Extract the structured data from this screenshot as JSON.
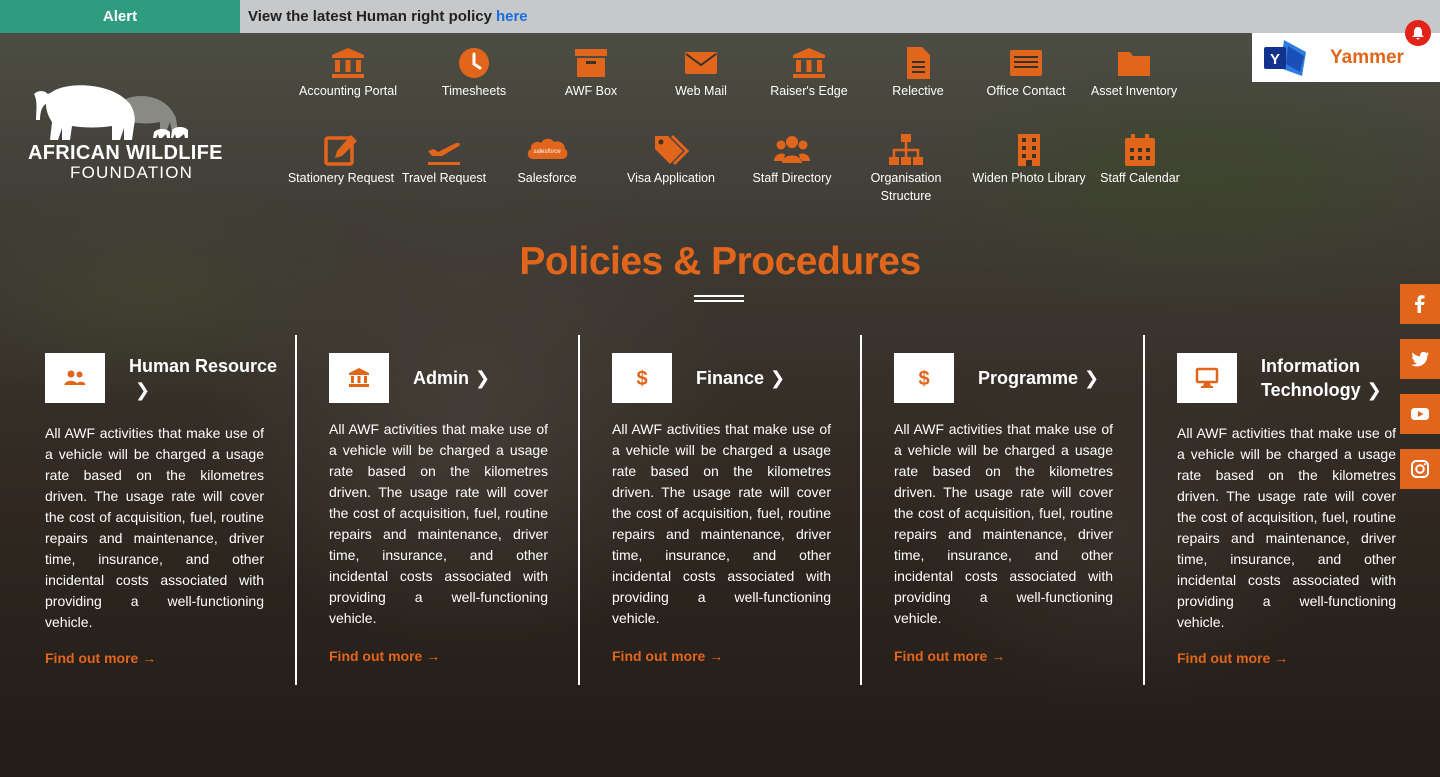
{
  "alert": {
    "label": "Alert",
    "text": "View the latest Human right policy",
    "link": "here"
  },
  "logo": {
    "line1": "AFRICAN WILDLIFE",
    "line2": "FOUNDATION"
  },
  "quick_links": [
    {
      "label": "Accounting Portal",
      "icon": "bank-icon"
    },
    {
      "label": "Timesheets",
      "icon": "clock-icon"
    },
    {
      "label": "AWF Box",
      "icon": "archive-box-icon"
    },
    {
      "label": "Web Mail",
      "icon": "envelope-icon"
    },
    {
      "label": "Raiser's Edge",
      "icon": "building-columns-icon"
    },
    {
      "label": "Relective",
      "icon": "document-icon"
    },
    {
      "label": "Office Contact",
      "icon": "address-card-icon"
    },
    {
      "label": "Asset Inventory",
      "icon": "folder-icon"
    },
    {
      "label": "Stationery Request",
      "icon": "edit-icon"
    },
    {
      "label": "Travel Request",
      "icon": "plane-departure-icon"
    },
    {
      "label": "Salesforce",
      "icon": "salesforce-cloud-icon"
    },
    {
      "label": "Visa Application",
      "icon": "tags-icon"
    },
    {
      "label": "Staff Directory",
      "icon": "users-icon"
    },
    {
      "label": "Organisation Structure",
      "icon": "sitemap-icon"
    },
    {
      "label": "Widen Photo Library",
      "icon": "building-icon"
    },
    {
      "label": "Staff Calendar",
      "icon": "calendar-icon"
    }
  ],
  "salesforce_text": "salesforce",
  "yammer": {
    "label": "Yammer",
    "icon_letter": "Y"
  },
  "policies": {
    "title": "Policies & Procedures",
    "link_label": "Find out more",
    "body": "All AWF activities that make use of a vehicle will be charged a usage rate based on the kilometres driven. The usage rate will cover the cost of acquisition, fuel, routine repairs and maintenance, driver time, insurance, and other incidental costs associated with providing a well-functioning vehicle.",
    "categories": [
      {
        "title": "Human Resource",
        "icon": "users-icon"
      },
      {
        "title": "Admin",
        "icon": "bank-icon"
      },
      {
        "title": "Finance",
        "icon": "dollar-icon"
      },
      {
        "title": "Programme",
        "icon": "dollar-icon"
      },
      {
        "title": "Information Technology",
        "icon": "desktop-icon"
      }
    ]
  },
  "social": [
    "facebook-icon",
    "twitter-icon",
    "youtube-icon",
    "instagram-icon"
  ],
  "colors": {
    "accent": "#e2651c",
    "alert_label_bg": "#2f9c82",
    "alert_bar_bg": "#c7c8c9",
    "link": "#1a6fe0",
    "notification": "#e2231a"
  }
}
